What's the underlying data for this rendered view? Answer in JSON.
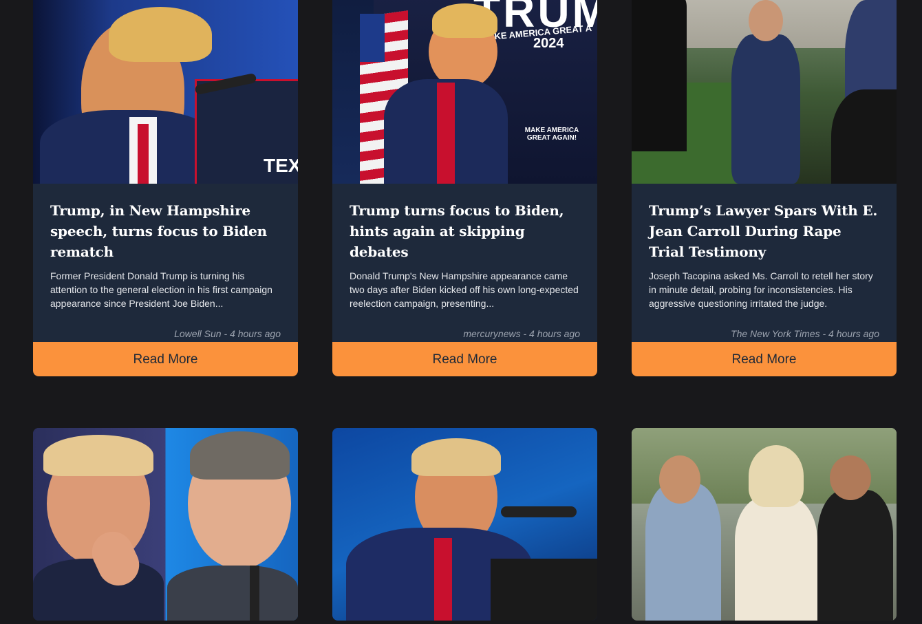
{
  "read_more_label": "Read More",
  "cards": [
    {
      "title": "Trump, in New Hampshire speech, turns focus to Biden rematch",
      "description": "Former President Donald Trump is turning his attention to the general election in his first campaign appearance since President Joe Biden...",
      "source": "Lowell Sun",
      "time": "4 hours ago"
    },
    {
      "title": "Trump turns focus to Biden, hints again at skipping debates",
      "description": "Donald Trump's New Hampshire appearance came two days after Biden kicked off his own long-expected reelection campaign, presenting...",
      "source": "mercurynews",
      "time": "4 hours ago",
      "image_text": {
        "big": "TRUM",
        "slogan": "MAKE AMERICA GREAT A",
        "year": "2024",
        "sign": "MAKE AMERICA GREAT AGAIN!"
      }
    },
    {
      "title": "Trump’s Lawyer Spars With E. Jean Carroll During Rape Trial Testimony",
      "description": "Joseph Tacopina asked Ms. Carroll to retell her story in minute detail, probing for inconsistencies. His aggressive questioning irritated the judge.",
      "source": "The New York Times",
      "time": "4 hours ago"
    },
    {
      "title": "",
      "description": "",
      "source": "",
      "time": ""
    },
    {
      "title": "",
      "description": "",
      "source": "",
      "time": ""
    },
    {
      "title": "",
      "description": "",
      "source": "",
      "time": ""
    }
  ],
  "meta_separator": " - ",
  "image_text": {
    "tex": "TEX"
  }
}
